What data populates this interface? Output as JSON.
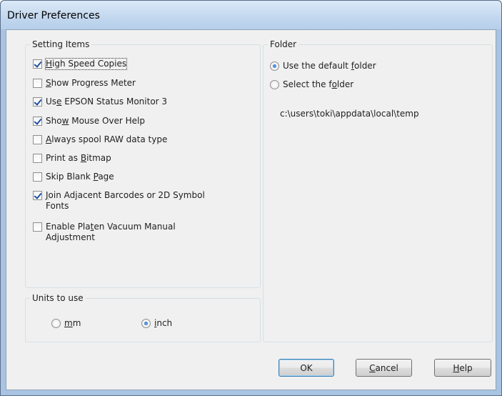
{
  "window": {
    "title": "Driver Preferences"
  },
  "setting_items": {
    "legend": "Setting Items",
    "items": [
      {
        "pre": "",
        "key": "H",
        "post": "igh Speed Copies",
        "checked": true
      },
      {
        "pre": "",
        "key": "S",
        "post": "how Progress Meter",
        "checked": false
      },
      {
        "pre": "Us",
        "key": "e",
        "post": " EPSON Status Monitor 3",
        "checked": true
      },
      {
        "pre": "Sho",
        "key": "w",
        "post": " Mouse Over Help",
        "checked": true
      },
      {
        "pre": "",
        "key": "A",
        "post": "lways spool RAW data type",
        "checked": false
      },
      {
        "pre": "Print as ",
        "key": "B",
        "post": "itmap",
        "checked": false
      },
      {
        "pre": "Skip Blank ",
        "key": "P",
        "post": "age",
        "checked": false
      },
      {
        "pre": "",
        "key": "J",
        "post": "oin Adjacent Barcodes or 2D Symbol Fonts",
        "checked": true
      },
      {
        "pre": "Enable Pla",
        "key": "t",
        "post": "en Vacuum Manual Adjustment",
        "checked": false
      }
    ]
  },
  "units": {
    "legend": "Units to use",
    "mm": {
      "pre": "",
      "key": "m",
      "post": "m",
      "selected": false
    },
    "inch": {
      "pre": "",
      "key": "i",
      "post": "nch",
      "selected": true
    }
  },
  "folder": {
    "legend": "Folder",
    "default_option": {
      "pre": "Use the default ",
      "key": "f",
      "post": "older",
      "selected": true
    },
    "select_option": {
      "pre": "Select the f",
      "key": "o",
      "post": "lder",
      "selected": false
    },
    "path": "c:\\users\\toki\\appdata\\local\\temp"
  },
  "buttons": {
    "ok": "OK",
    "cancel": {
      "key": "C",
      "post": "ancel"
    },
    "help": {
      "key": "H",
      "post": "elp"
    }
  }
}
